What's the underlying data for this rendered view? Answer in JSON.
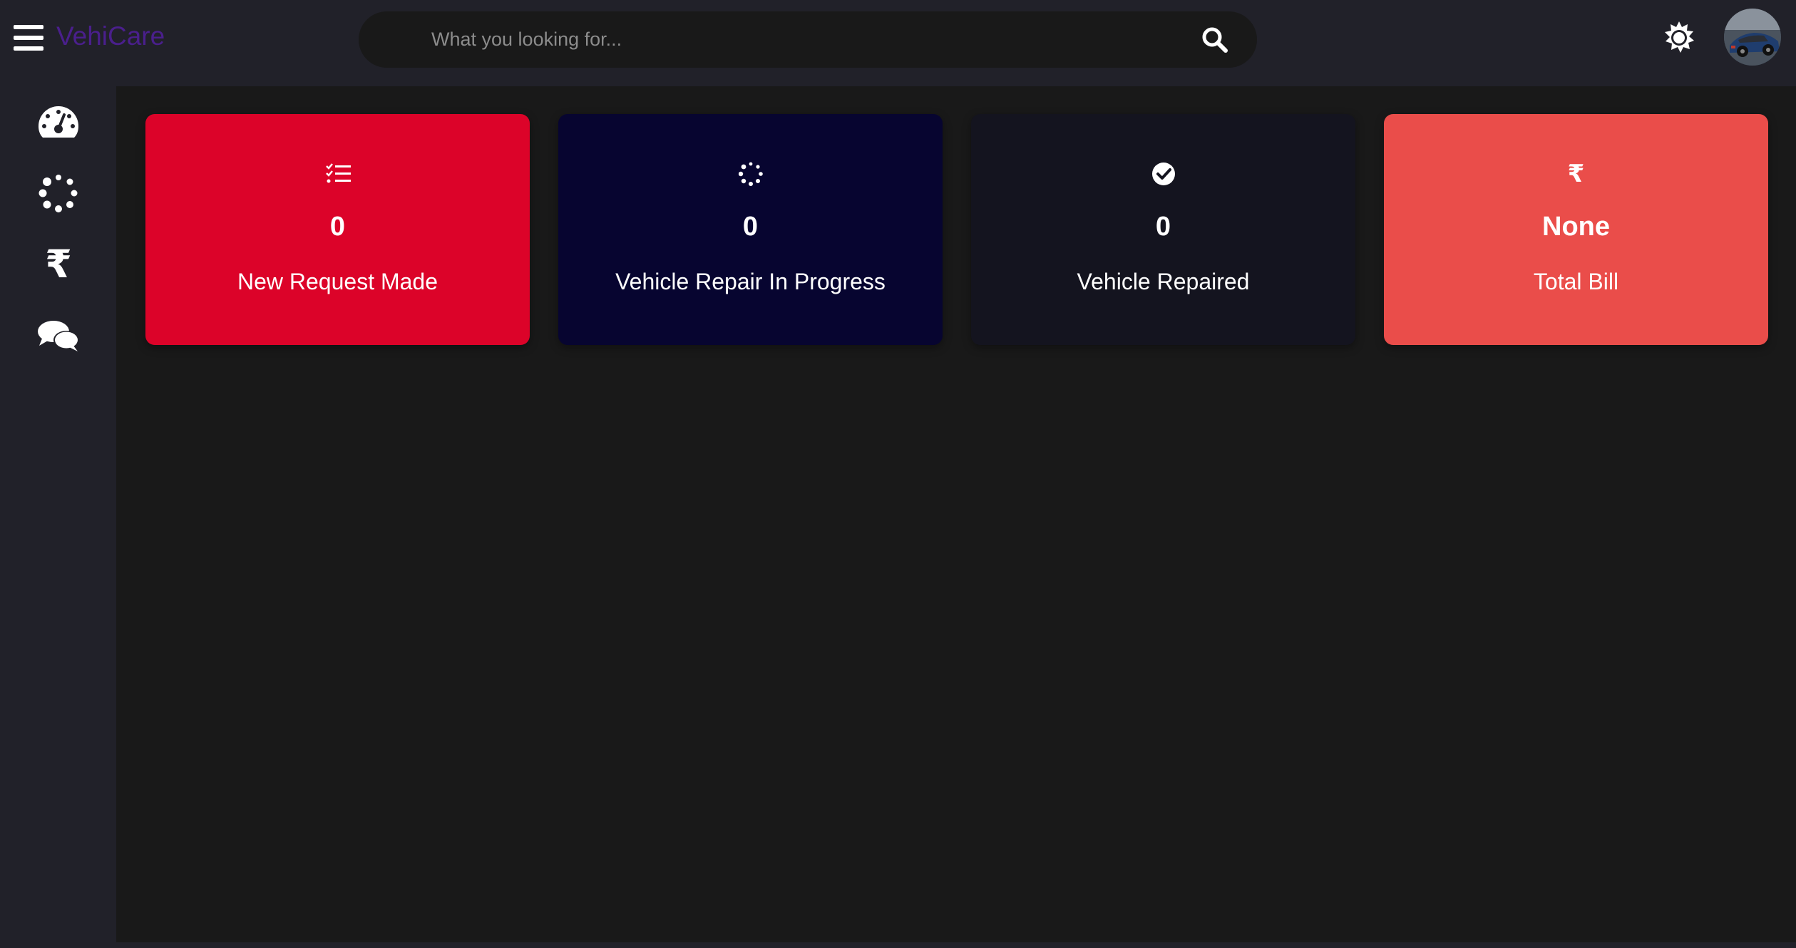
{
  "header": {
    "brand": "VehiCare",
    "brand_color": "#4a1f8c",
    "menu_icon": "hamburger-icon",
    "search": {
      "placeholder": "What you looking for...",
      "value": "",
      "icon": "search-icon"
    },
    "theme_icon": "sun-icon",
    "avatar": "user-avatar"
  },
  "sidebar": {
    "items": [
      {
        "icon": "dashboard-gauge-icon"
      },
      {
        "icon": "spinner-icon"
      },
      {
        "icon": "rupee-icon",
        "glyph": "₹"
      },
      {
        "icon": "chat-icon"
      }
    ]
  },
  "cards": [
    {
      "icon": "checklist-icon",
      "value": "0",
      "label": "New Request Made",
      "color": "#dc0329"
    },
    {
      "icon": "spinner-icon",
      "value": "0",
      "label": "Vehicle Repair In Progress",
      "color": "#070530"
    },
    {
      "icon": "check-circle-icon",
      "value": "0",
      "label": "Vehicle Repaired",
      "color": "#14141f"
    },
    {
      "icon": "rupee-icon",
      "glyph": "₹",
      "value": "None",
      "label": "Total Bill",
      "color": "#ea4d4a"
    }
  ]
}
